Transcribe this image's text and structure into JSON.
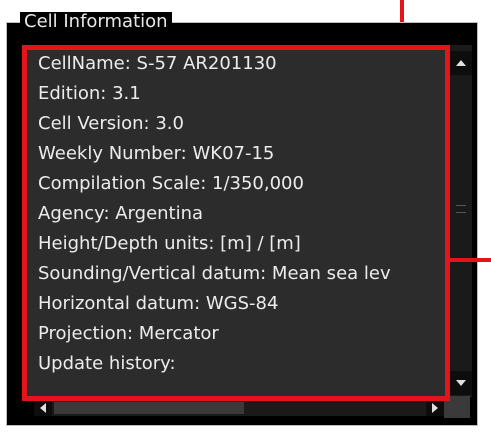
{
  "window": {
    "group_title": "Cell Information"
  },
  "cell_info": {
    "lines": [
      "CellName: S-57 AR201130",
      "Edition: 3.1",
      "Cell Version: 3.0",
      "Weekly Number: WK07-15",
      "Compilation Scale: 1/350,000",
      "Agency: Argentina",
      "Height/Depth units: [m] / [m]",
      "Sounding/Vertical datum: Mean sea lev",
      "Horizontal datum: WGS-84",
      "Projection: Mercator",
      "Update history:"
    ]
  },
  "icons": {
    "scroll_up": "triangle-up-icon",
    "scroll_down": "triangle-down-icon",
    "scroll_left": "triangle-left-icon",
    "scroll_right": "triangle-right-icon"
  },
  "colors": {
    "highlight": "#e4141c",
    "panel_background": "#000000",
    "text_area_background": "#2c2c2c",
    "text": "#ececec"
  }
}
